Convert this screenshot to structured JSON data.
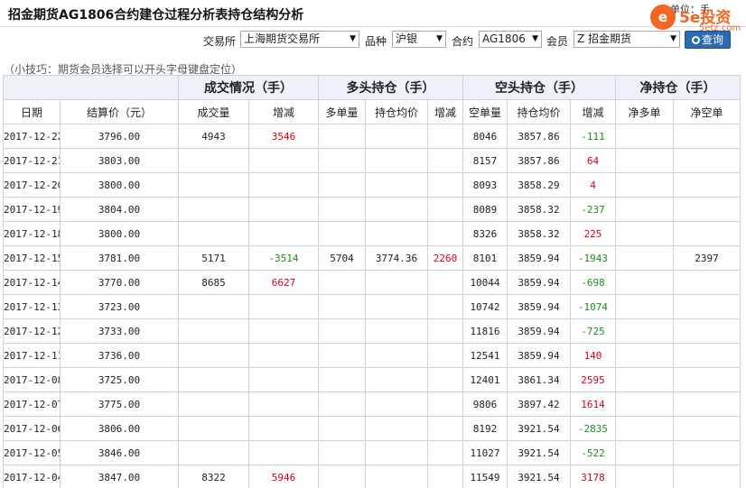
{
  "header": {
    "title": "招金期货AG1806合约建仓过程分析表持仓结构分析",
    "unit": "单位：手"
  },
  "logo": {
    "glyph": "e",
    "brand": "5e投资",
    "domain": "5etz.com"
  },
  "filters": {
    "exchange_label": "交易所",
    "exchange_value": "上海期货交易所",
    "product_label": "品种",
    "product_value": "沪银",
    "contract_label": "合约",
    "contract_value": "AG1806",
    "member_label": "会员",
    "member_value": "Z 招金期货",
    "query_label": "查询"
  },
  "tip": "（小技巧：期货会员选择可以开头字母键盘定位）",
  "table": {
    "groups": {
      "volume": "成交情况（手）",
      "long": "多头持仓（手）",
      "short": "空头持仓（手）",
      "net": "净持仓（手）"
    },
    "columns": [
      "日期",
      "结算价（元）",
      "成交量",
      "增减",
      "多单量",
      "持仓均价",
      "增减",
      "空单量",
      "持仓均价",
      "增减",
      "净多单",
      "净空单"
    ],
    "rows": [
      {
        "date": "2017-12-22",
        "settle": "3796.00",
        "vol": "4943",
        "vol_chg": "3546",
        "vol_chg_color": "red",
        "long_qty": "",
        "long_avg": "",
        "long_chg": "",
        "long_chg_color": "",
        "short_qty": "8046",
        "short_avg": "3857.86",
        "short_chg": "-111",
        "short_chg_color": "green",
        "net_long": "",
        "net_short": ""
      },
      {
        "date": "2017-12-21",
        "settle": "3803.00",
        "vol": "",
        "vol_chg": "",
        "vol_chg_color": "",
        "long_qty": "",
        "long_avg": "",
        "long_chg": "",
        "long_chg_color": "",
        "short_qty": "8157",
        "short_avg": "3857.86",
        "short_chg": "64",
        "short_chg_color": "red",
        "net_long": "",
        "net_short": ""
      },
      {
        "date": "2017-12-20",
        "settle": "3800.00",
        "vol": "",
        "vol_chg": "",
        "vol_chg_color": "",
        "long_qty": "",
        "long_avg": "",
        "long_chg": "",
        "long_chg_color": "",
        "short_qty": "8093",
        "short_avg": "3858.29",
        "short_chg": "4",
        "short_chg_color": "red",
        "net_long": "",
        "net_short": ""
      },
      {
        "date": "2017-12-19",
        "settle": "3804.00",
        "vol": "",
        "vol_chg": "",
        "vol_chg_color": "",
        "long_qty": "",
        "long_avg": "",
        "long_chg": "",
        "long_chg_color": "",
        "short_qty": "8089",
        "short_avg": "3858.32",
        "short_chg": "-237",
        "short_chg_color": "green",
        "net_long": "",
        "net_short": ""
      },
      {
        "date": "2017-12-18",
        "settle": "3800.00",
        "vol": "",
        "vol_chg": "",
        "vol_chg_color": "",
        "long_qty": "",
        "long_avg": "",
        "long_chg": "",
        "long_chg_color": "",
        "short_qty": "8326",
        "short_avg": "3858.32",
        "short_chg": "225",
        "short_chg_color": "red",
        "net_long": "",
        "net_short": ""
      },
      {
        "date": "2017-12-15",
        "settle": "3781.00",
        "vol": "5171",
        "vol_chg": "-3514",
        "vol_chg_color": "green",
        "long_qty": "5704",
        "long_avg": "3774.36",
        "long_chg": "2260",
        "long_chg_color": "red",
        "short_qty": "8101",
        "short_avg": "3859.94",
        "short_chg": "-1943",
        "short_chg_color": "green",
        "net_long": "",
        "net_short": "2397"
      },
      {
        "date": "2017-12-14",
        "settle": "3770.00",
        "vol": "8685",
        "vol_chg": "6627",
        "vol_chg_color": "red",
        "long_qty": "",
        "long_avg": "",
        "long_chg": "",
        "long_chg_color": "",
        "short_qty": "10044",
        "short_avg": "3859.94",
        "short_chg": "-698",
        "short_chg_color": "green",
        "net_long": "",
        "net_short": ""
      },
      {
        "date": "2017-12-13",
        "settle": "3723.00",
        "vol": "",
        "vol_chg": "",
        "vol_chg_color": "",
        "long_qty": "",
        "long_avg": "",
        "long_chg": "",
        "long_chg_color": "",
        "short_qty": "10742",
        "short_avg": "3859.94",
        "short_chg": "-1074",
        "short_chg_color": "green",
        "net_long": "",
        "net_short": ""
      },
      {
        "date": "2017-12-12",
        "settle": "3733.00",
        "vol": "",
        "vol_chg": "",
        "vol_chg_color": "",
        "long_qty": "",
        "long_avg": "",
        "long_chg": "",
        "long_chg_color": "",
        "short_qty": "11816",
        "short_avg": "3859.94",
        "short_chg": "-725",
        "short_chg_color": "green",
        "net_long": "",
        "net_short": ""
      },
      {
        "date": "2017-12-11",
        "settle": "3736.00",
        "vol": "",
        "vol_chg": "",
        "vol_chg_color": "",
        "long_qty": "",
        "long_avg": "",
        "long_chg": "",
        "long_chg_color": "",
        "short_qty": "12541",
        "short_avg": "3859.94",
        "short_chg": "140",
        "short_chg_color": "red",
        "net_long": "",
        "net_short": ""
      },
      {
        "date": "2017-12-08",
        "settle": "3725.00",
        "vol": "",
        "vol_chg": "",
        "vol_chg_color": "",
        "long_qty": "",
        "long_avg": "",
        "long_chg": "",
        "long_chg_color": "",
        "short_qty": "12401",
        "short_avg": "3861.34",
        "short_chg": "2595",
        "short_chg_color": "red",
        "net_long": "",
        "net_short": ""
      },
      {
        "date": "2017-12-07",
        "settle": "3775.00",
        "vol": "",
        "vol_chg": "",
        "vol_chg_color": "",
        "long_qty": "",
        "long_avg": "",
        "long_chg": "",
        "long_chg_color": "",
        "short_qty": "9806",
        "short_avg": "3897.42",
        "short_chg": "1614",
        "short_chg_color": "red",
        "net_long": "",
        "net_short": ""
      },
      {
        "date": "2017-12-06",
        "settle": "3806.00",
        "vol": "",
        "vol_chg": "",
        "vol_chg_color": "",
        "long_qty": "",
        "long_avg": "",
        "long_chg": "",
        "long_chg_color": "",
        "short_qty": "8192",
        "short_avg": "3921.54",
        "short_chg": "-2835",
        "short_chg_color": "green",
        "net_long": "",
        "net_short": ""
      },
      {
        "date": "2017-12-05",
        "settle": "3846.00",
        "vol": "",
        "vol_chg": "",
        "vol_chg_color": "",
        "long_qty": "",
        "long_avg": "",
        "long_chg": "",
        "long_chg_color": "",
        "short_qty": "11027",
        "short_avg": "3921.54",
        "short_chg": "-522",
        "short_chg_color": "green",
        "net_long": "",
        "net_short": ""
      },
      {
        "date": "2017-12-04",
        "settle": "3847.00",
        "vol": "8322",
        "vol_chg": "5946",
        "vol_chg_color": "red",
        "long_qty": "",
        "long_avg": "",
        "long_chg": "",
        "long_chg_color": "",
        "short_qty": "11549",
        "short_avg": "3921.54",
        "short_chg": "3178",
        "short_chg_color": "red",
        "net_long": "",
        "net_short": ""
      }
    ]
  }
}
